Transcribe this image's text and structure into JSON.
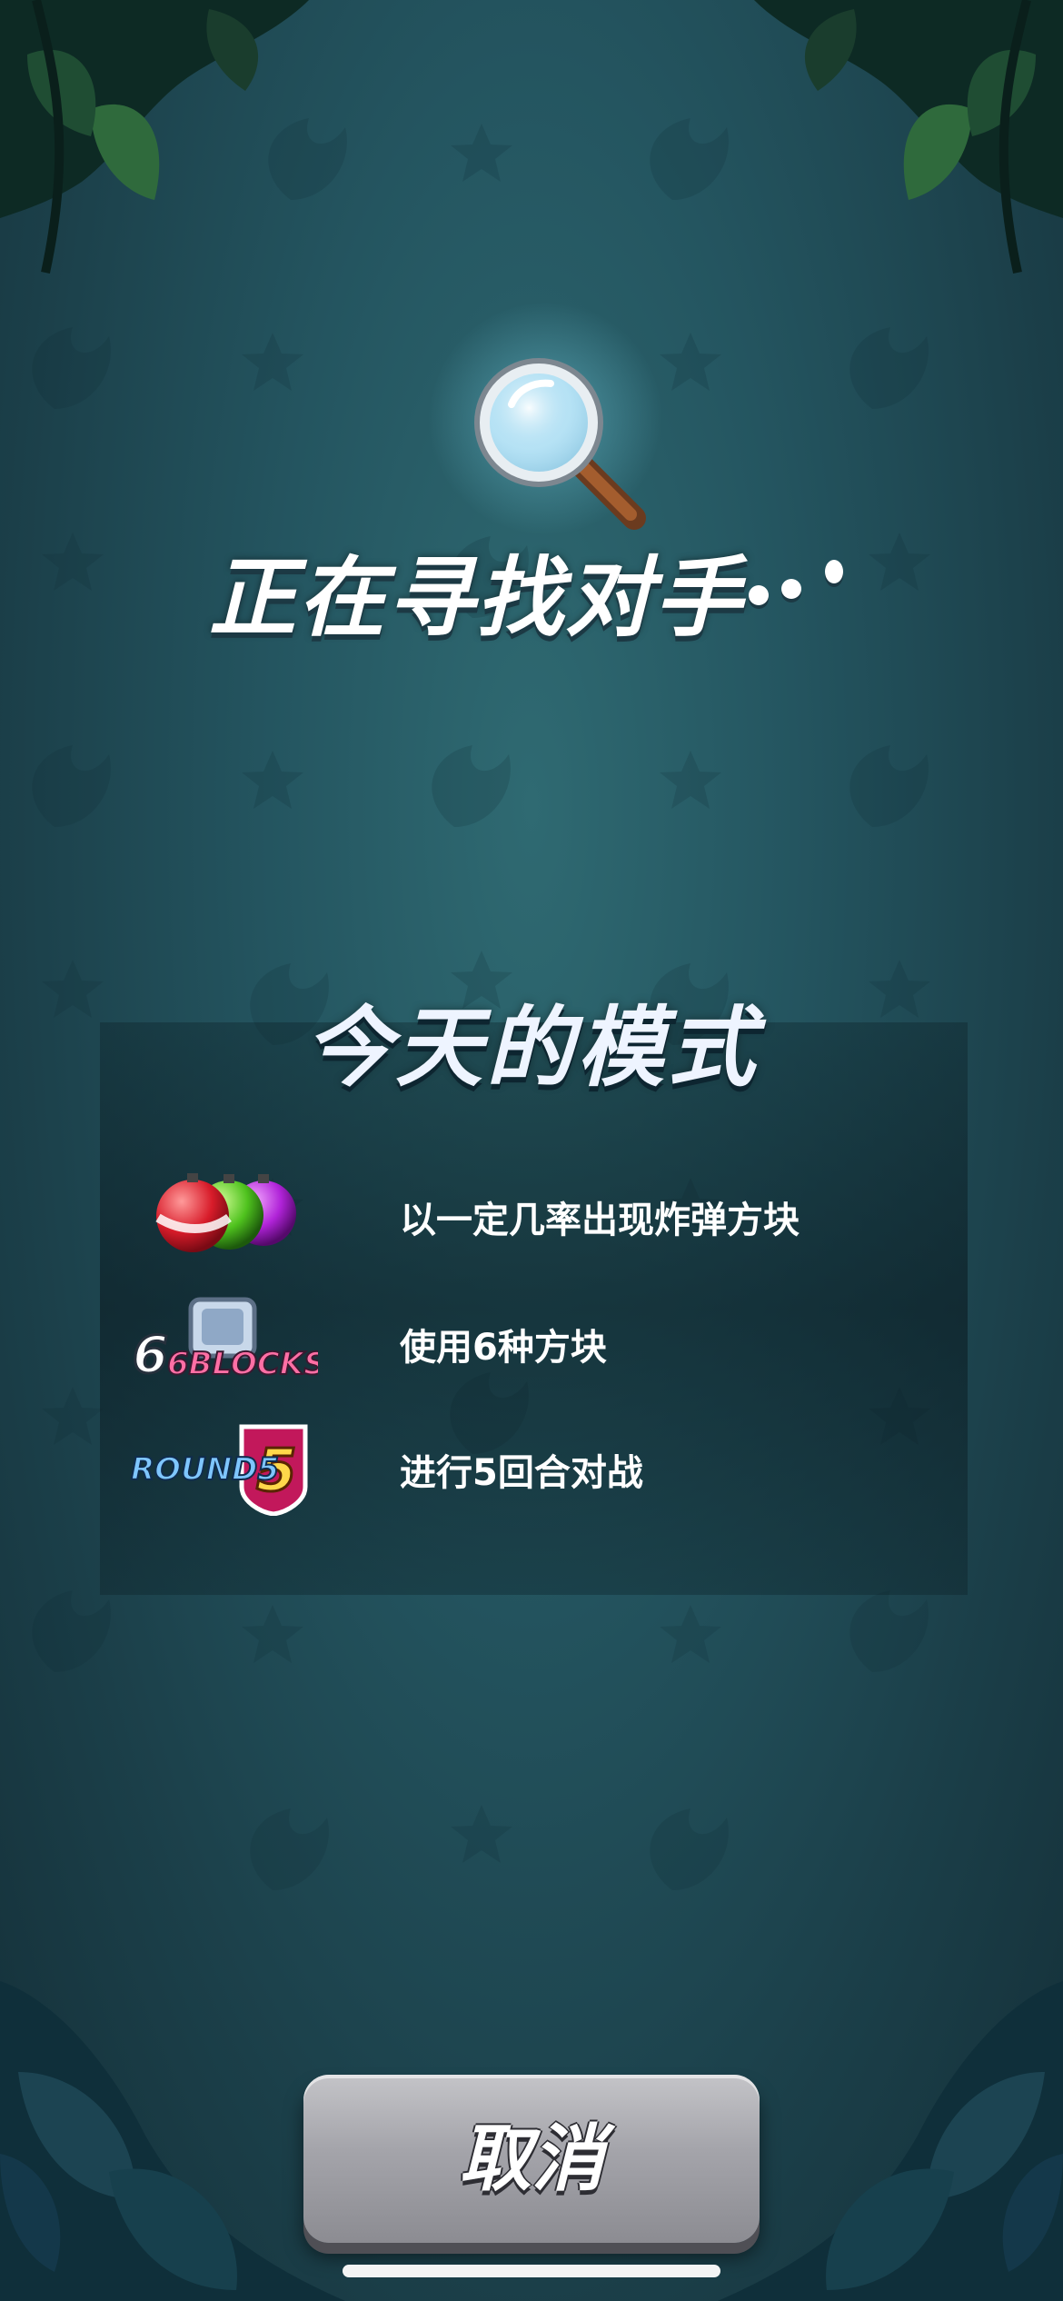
{
  "matchmaking": {
    "status_text": "正在寻找对手"
  },
  "mode": {
    "title": "今天的模式",
    "rules": [
      {
        "icon": "bomb-blocks-icon",
        "text": "以一定几率出现炸弹方块"
      },
      {
        "icon": "6-blocks-icon",
        "icon_label": "6BLOCKS",
        "text": "使用6种方块"
      },
      {
        "icon": "round-5-icon",
        "icon_label": "ROUND5",
        "text": "进行5回合对战"
      }
    ]
  },
  "cancel_button": {
    "label": "取消"
  },
  "colors": {
    "background": "#245560",
    "button": "#a4a4aa",
    "text": "#ffffff"
  }
}
